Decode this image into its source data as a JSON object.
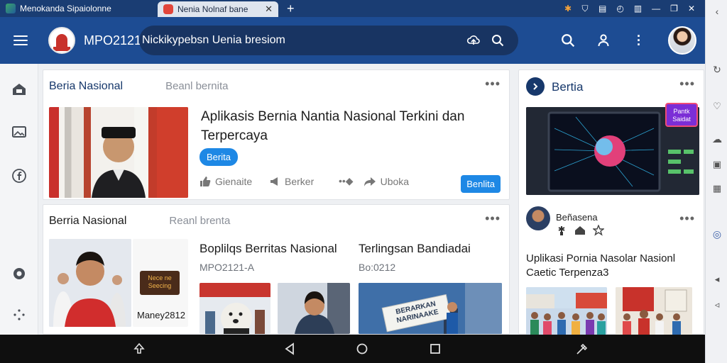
{
  "browser": {
    "tabs": [
      {
        "label": "Menokanda Sipaiolonne",
        "active": false
      },
      {
        "label": "Nenia Nolnaf bane",
        "active": true
      }
    ],
    "new_tab": "+",
    "window_icons": [
      "extension-icon",
      "shield-icon",
      "reader-icon",
      "history-icon",
      "split-view-icon",
      "minimize-icon",
      "restore-icon",
      "close-icon"
    ]
  },
  "app": {
    "title": "MPO2121 -",
    "search": {
      "value": "Nickikypebsn Uenia bresiom"
    },
    "colors": {
      "appbar": "#1d4c93",
      "accent": "#1e88e5",
      "badge_purple": "#7b2ed6"
    }
  },
  "feed": {
    "card1": {
      "section": "Beria Nasional",
      "subtitle": "Beanl bernita",
      "headline": "Aplikasis Bernia Nantia Nasional Terkini dan Terpercaya",
      "badge": "Berita",
      "actions": {
        "like": "Gienaite",
        "bookmark": "Berker",
        "share": "Uboka"
      },
      "primary_button": "Benlita"
    },
    "card2": {
      "section": "Berria Nasional",
      "subtitle": "Reanl brenta",
      "thumb_caption": "Maney2812",
      "thumb_badge": "Nece ne Seecing",
      "col1": {
        "title": "Boplilqs Berritas Nasional",
        "sub": "MPO2121-A"
      },
      "col2": {
        "title": "Terlingsan Bandiadai",
        "sub": "Bo:0212"
      },
      "sign_text": "BERARKAN NARINAAKE"
    }
  },
  "panel": {
    "title": "Bertia",
    "tag": "Pantk Saidat",
    "post": {
      "name": "Beñasena",
      "title": "Uplikasi Pornia Nasolar Nasionl Caetic Terpenza3"
    }
  }
}
